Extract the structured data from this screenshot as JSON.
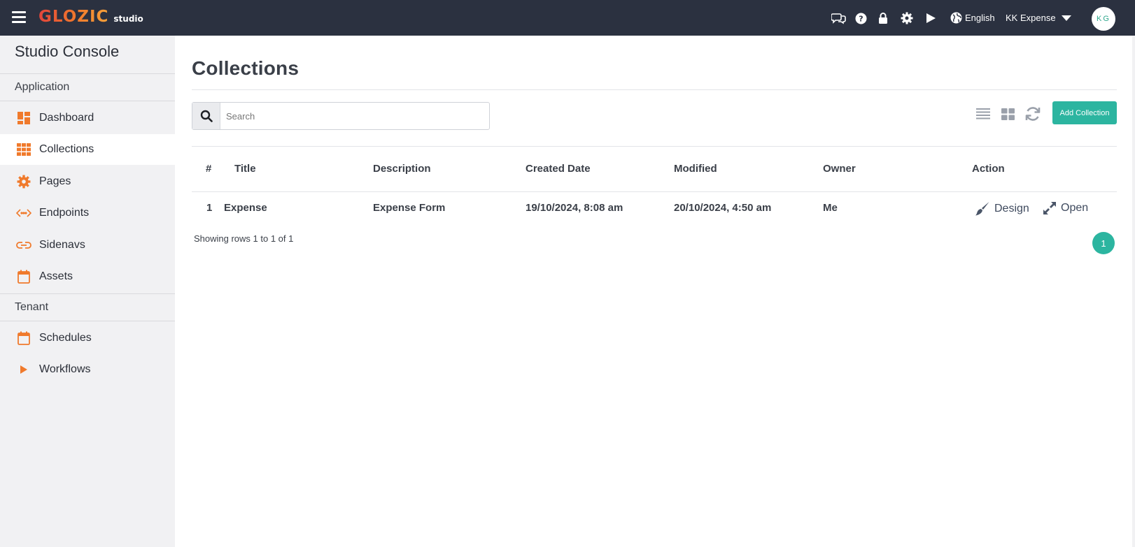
{
  "topbar": {
    "brand": "GLOZIC",
    "brand_sub": "studio",
    "icons": [
      "chat-icon",
      "help-icon",
      "lock-icon",
      "gear-icon",
      "play-icon"
    ],
    "language": "English",
    "tenant": "KK Expense",
    "avatar_initials": "KG"
  },
  "sidebar": {
    "title": "Studio Console",
    "sections": [
      {
        "label": "Application",
        "items": [
          {
            "label": "Dashboard",
            "icon": "dashboard-icon"
          },
          {
            "label": "Collections",
            "icon": "grid-icon",
            "active": true
          },
          {
            "label": "Pages",
            "icon": "gear-icon"
          },
          {
            "label": "Endpoints",
            "icon": "code-icon"
          },
          {
            "label": "Sidenavs",
            "icon": "link-icon"
          },
          {
            "label": "Assets",
            "icon": "calendar-icon"
          }
        ]
      },
      {
        "label": "Tenant",
        "items": [
          {
            "label": "Schedules",
            "icon": "calendar-icon"
          },
          {
            "label": "Workflows",
            "icon": "play-icon"
          }
        ]
      }
    ]
  },
  "main": {
    "title": "Collections",
    "search": {
      "placeholder": "Search",
      "value": ""
    },
    "add_button": "Add Collection",
    "view_buttons": [
      "list-view-icon",
      "grid-view-icon",
      "refresh-icon"
    ],
    "table": {
      "headers": [
        "#",
        "Title",
        "Description",
        "Created Date",
        "Modified",
        "Owner",
        "Action"
      ],
      "rows": [
        {
          "num": "1",
          "title": "Expense",
          "description": "Expense Form",
          "created": "19/10/2024, 8:08 am",
          "modified": "20/10/2024, 4:50 am",
          "owner": "Me",
          "actions": [
            "Design",
            "Open"
          ]
        }
      ]
    },
    "showing": "Showing rows 1 to 1 of 1",
    "current_page": "1"
  },
  "colors": {
    "topbar_bg": "#2b3140",
    "accent": "#2cb5a0",
    "sidebar_icon": "#f07a2c",
    "sidebar_bg": "#f1f1f3"
  }
}
